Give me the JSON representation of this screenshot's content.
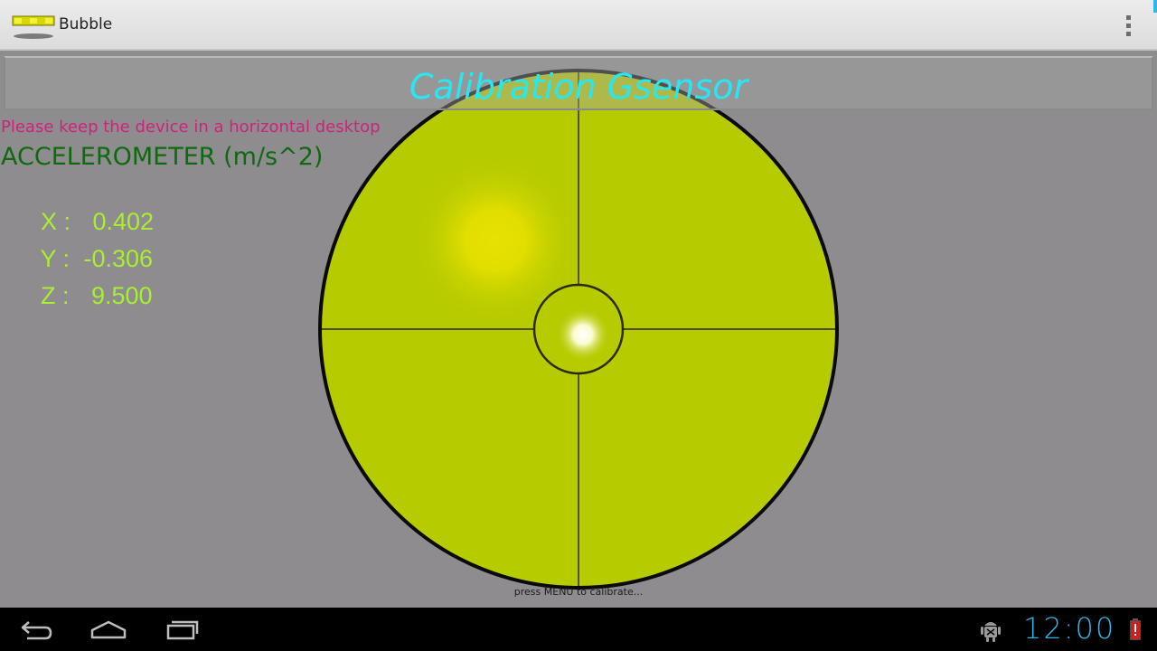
{
  "app": {
    "title": "Bubble",
    "icon": "spirit-level-icon"
  },
  "title_bar": {
    "text": "Calibration Gsensor"
  },
  "hint": "Please keep the device in a horizontal desktop",
  "accelerometer": {
    "title": "ACCELEROMETER (m/s^2)",
    "rows": [
      {
        "label": "X :",
        "value": "0.402"
      },
      {
        "label": "Y :",
        "value": "-0.306"
      },
      {
        "label": "Z :",
        "value": "9.500"
      }
    ]
  },
  "footer_hint": "press MENU to calibrate...",
  "status": {
    "clock": "12:00"
  },
  "colors": {
    "accent": "#33b5e5",
    "scope_fill": "#b6cb00",
    "title_text": "#26e8f3",
    "hint_text": "#cd237b",
    "value_text": "#a8ef32",
    "heading_text": "#0f690f"
  },
  "icons": {
    "overflow": "overflow-menu-icon",
    "back": "back-icon",
    "home": "home-icon",
    "recents": "recent-apps-icon",
    "debug": "android-debug-icon",
    "battery": "battery-low-icon"
  }
}
